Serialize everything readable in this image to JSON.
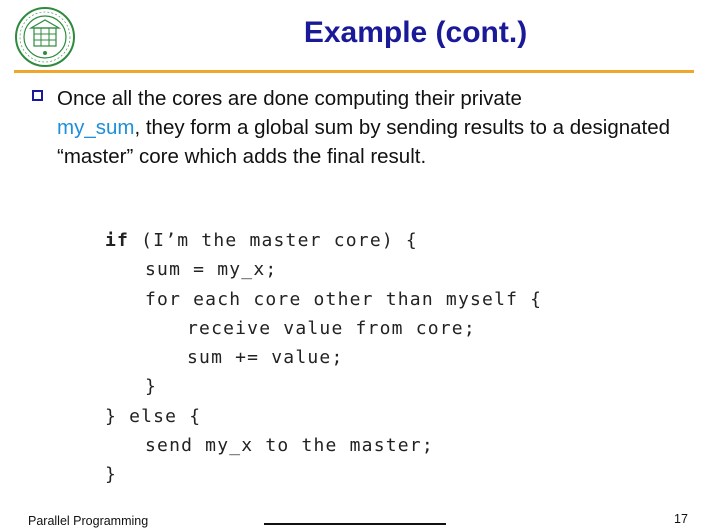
{
  "slide": {
    "title": "Example (cont.)"
  },
  "bullet": {
    "text_before": "Once all the cores are done computing their private",
    "highlight": "my_sum",
    "text_after": ", they form a global sum by sending results to a designated “master” core which adds the final result."
  },
  "code": {
    "lines": [
      {
        "keyword": "if",
        "rest": " (I’m the master core) {"
      },
      {
        "keyword": "",
        "rest": "sum = my_x;"
      },
      {
        "keyword": "",
        "rest": "for each core other than myself {"
      },
      {
        "keyword": "",
        "rest": "receive value from core;"
      },
      {
        "keyword": "",
        "rest": "sum += value;"
      },
      {
        "keyword": "",
        "rest": "}"
      },
      {
        "keyword": "",
        "rest": "} else {"
      },
      {
        "keyword": "",
        "rest": "send my_x to the master;"
      },
      {
        "keyword": "",
        "rest": "}"
      }
    ]
  },
  "footer": {
    "course": "Parallel Programming",
    "page_number": "17"
  },
  "colors": {
    "title": "#1a1a99",
    "rule": "#f0a62a",
    "highlight": "#1e8fd9",
    "logo": "#2e8b3e"
  },
  "logo": {
    "icon": "university-seal-icon",
    "seal_text": "SOOCHOW UNIVERSITY"
  }
}
